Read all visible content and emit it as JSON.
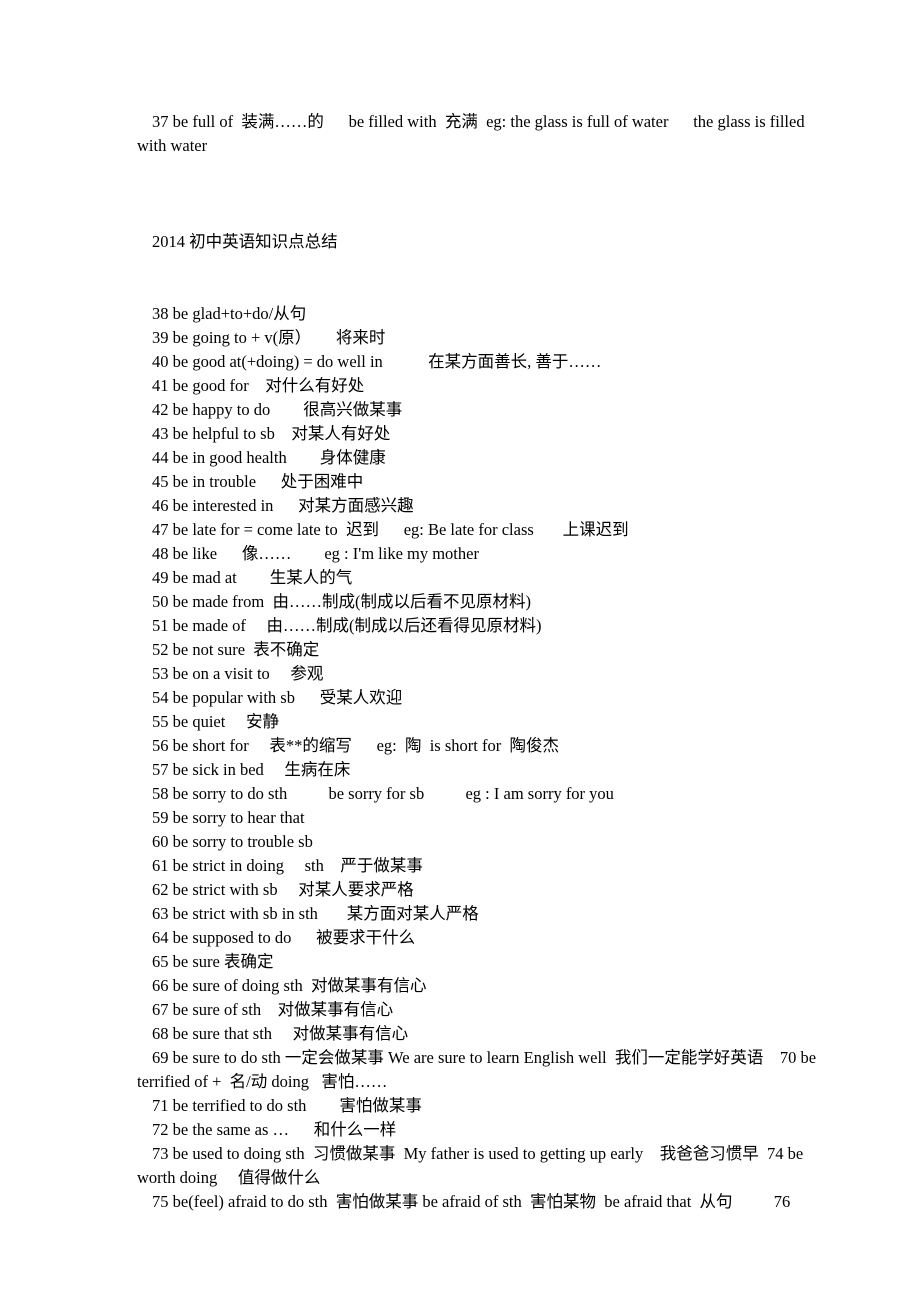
{
  "document": {
    "title_line": "2014 初中英语知识点总结",
    "intro_entry": "37 be full of  装满……的      be filled with  充满  eg: the glass is full of water      the glass is filled with water",
    "entries": [
      "38 be glad+to+do/从句",
      "39 be going to + v(原）      将来时",
      "40 be good at(+doing) = do well in           在某方面善长, 善于……",
      "41 be good for    对什么有好处",
      "42 be happy to do        很高兴做某事",
      "43 be helpful to sb    对某人有好处",
      "44 be in good health        身体健康",
      "45 be in trouble      处于困难中",
      "46 be interested in      对某方面感兴趣",
      "47 be late for = come late to  迟到      eg: Be late for class       上课迟到",
      "48 be like      像……        eg : I'm like my mother",
      "49 be mad at        生某人的气",
      "50 be made from  由……制成(制成以后看不见原材料)",
      "51 be made of     由……制成(制成以后还看得见原材料)",
      "52 be not sure  表不确定",
      "53 be on a visit to     参观",
      "54 be popular with sb      受某人欢迎",
      "55 be quiet     安静",
      "56 be short for     表**的缩写      eg:  陶  is short for  陶俊杰",
      "57 be sick in bed     生病在床",
      "58 be sorry to do sth          be sorry for sb          eg : I am sorry for you",
      "59 be sorry to hear that",
      "60 be sorry to trouble sb",
      "61 be strict in doing     sth    严于做某事",
      "62 be strict with sb     对某人要求严格",
      "63 be strict with sb in sth       某方面对某人严格",
      "64 be supposed to do      被要求干什么",
      "65 be sure 表确定",
      "66 be sure of doing sth  对做某事有信心",
      "67 be sure of sth    对做某事有信心",
      "68 be sure that sth     对做某事有信心",
      "69 be sure to do sth 一定会做某事 We are sure to learn English well  我们一定能学好英语    70 be terrified of +  名/动 doing   害怕……",
      "71 be terrified to do sth        害怕做某事",
      "72 be the same as …      和什么一样",
      "73 be used to doing sth  习惯做某事  My father is used to getting up early    我爸爸习惯早  74 be worth doing     值得做什么",
      "75 be(feel) afraid to do sth  害怕做某事 be afraid of sth  害怕某物  be afraid that  从句          76"
    ]
  }
}
